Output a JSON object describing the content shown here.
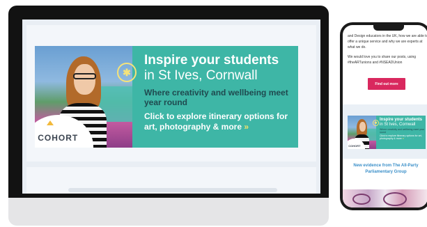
{
  "banner": {
    "headline": "Inspire your students",
    "location": "in St Ives, Cornwall",
    "subline": "Where creativity and wellbeing meet year round",
    "cta": "Click to explore itinerary options for art, photography & more",
    "cta_arrow": "»",
    "logo_text": "COHORT",
    "icon": "lightbulb-icon",
    "colors": {
      "background": "#3eb6a6",
      "subline": "#1f4a4f",
      "arrow": "#f2e26a"
    }
  },
  "phone": {
    "intro_text": "and Design educators in the UK, how we are able to offer a unique service and why we are experts at what we do.",
    "share_text": "We would love you to share our posts, using #theARTunions and #NSEADUnion",
    "find_out_more_label": "Find out more",
    "section_heading": "New evidence from The All-Party Parliamentary Group",
    "colors": {
      "button": "#d9285e",
      "heading": "#3a8fc9"
    }
  }
}
